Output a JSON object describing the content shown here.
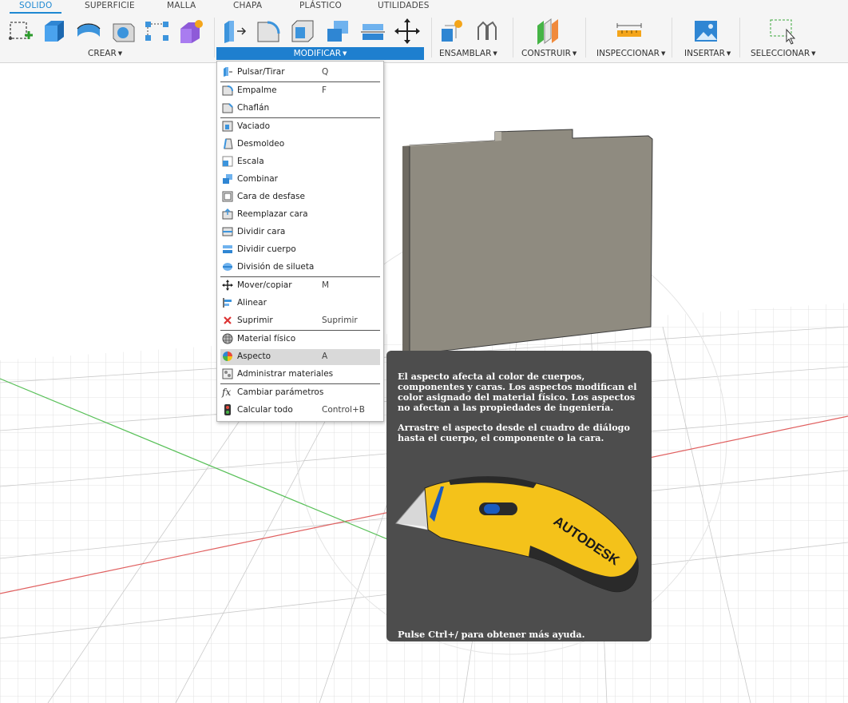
{
  "tabs": [
    "SOLIDO",
    "SUPERFICIE",
    "MALLA",
    "CHAPA",
    "PLÁSTICO",
    "UTILIDADES"
  ],
  "active_tab": "SOLIDO",
  "groups": {
    "crear": "CREAR",
    "modificar": "MODIFICAR",
    "ensamblar": "ENSAMBLAR",
    "construir": "CONSTRUIR",
    "inspeccionar": "INSPECCIONAR",
    "insertar": "INSERTAR",
    "seleccionar": "SELECCIONAR"
  },
  "toolbar_icons": {
    "crear": [
      "create-sketch-icon",
      "extrude-icon",
      "revolve-icon",
      "hole-icon",
      "pattern-icon",
      "create-form-icon"
    ],
    "modificar": [
      "press-pull-icon",
      "fillet-icon",
      "shell-icon",
      "combine-icon",
      "split-body-icon",
      "move-icon"
    ],
    "ensamblar": [
      "new-component-icon",
      "joint-icon"
    ],
    "construir": [
      "offset-plane-icon"
    ],
    "inspeccionar": [
      "measure-icon"
    ],
    "insertar": [
      "insert-image-icon"
    ],
    "seleccionar": [
      "window-select-icon"
    ]
  },
  "menu": {
    "items": [
      {
        "label": "Pulsar/Tirar",
        "shortcut": "Q",
        "icon": "press-pull-icon"
      },
      {
        "label": "Empalme",
        "shortcut": "F",
        "icon": "fillet-icon"
      },
      {
        "label": "Chaflán",
        "shortcut": "",
        "icon": "chamfer-icon"
      },
      {
        "label": "Vaciado",
        "shortcut": "",
        "icon": "shell-icon"
      },
      {
        "label": "Desmoldeo",
        "shortcut": "",
        "icon": "draft-icon"
      },
      {
        "label": "Escala",
        "shortcut": "",
        "icon": "scale-icon"
      },
      {
        "label": "Combinar",
        "shortcut": "",
        "icon": "combine-icon"
      },
      {
        "label": "Cara de desfase",
        "shortcut": "",
        "icon": "offset-face-icon"
      },
      {
        "label": "Reemplazar cara",
        "shortcut": "",
        "icon": "replace-face-icon"
      },
      {
        "label": "Dividir cara",
        "shortcut": "",
        "icon": "split-face-icon"
      },
      {
        "label": "Dividir cuerpo",
        "shortcut": "",
        "icon": "split-body-icon"
      },
      {
        "label": "División de silueta",
        "shortcut": "",
        "icon": "silhouette-split-icon"
      },
      {
        "label": "Mover/copiar",
        "shortcut": "M",
        "icon": "move-icon"
      },
      {
        "label": "Alinear",
        "shortcut": "",
        "icon": "align-icon"
      },
      {
        "label": "Suprimir",
        "shortcut": "Suprimir",
        "icon": "delete-icon"
      },
      {
        "label": "Material físico",
        "shortcut": "",
        "icon": "physical-material-icon"
      },
      {
        "label": "Aspecto",
        "shortcut": "A",
        "icon": "appearance-icon",
        "highlighted": true
      },
      {
        "label": "Administrar materiales",
        "shortcut": "",
        "icon": "manage-materials-icon"
      },
      {
        "label": "Cambiar parámetros",
        "shortcut": "",
        "icon": "fx-icon"
      },
      {
        "label": "Calcular todo",
        "shortcut": "Control+B",
        "icon": "compute-all-icon"
      }
    ]
  },
  "tooltip": {
    "paragraph1": "El aspecto afecta al color de cuerpos, componentes y caras. Los aspectos modifican el color asignado del material físico. Los aspectos no afectan a las propiedades de ingeniería.",
    "paragraph2": "Arrastre el aspecto desde el cuadro de diálogo hasta el cuerpo, el componente o la cara.",
    "image_brand": "AUTODESK",
    "help": "Pulse Ctrl+/ para obtener más ayuda."
  },
  "colors": {
    "accent": "#1e7fcf",
    "tab_active": "#1e88d2",
    "tooltip_bg": "#4d4d4d",
    "menu_highlight": "#d9d9d9",
    "body_face": "#8f8b80",
    "axis_red": "#e06060",
    "axis_green": "#58c058"
  }
}
